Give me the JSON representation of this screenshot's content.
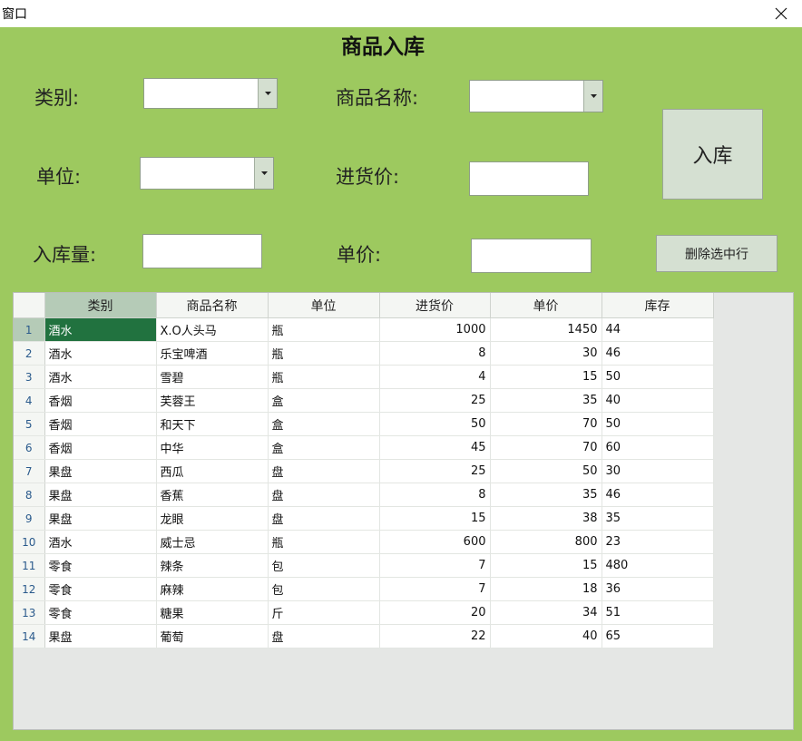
{
  "window": {
    "title": "窗口"
  },
  "form": {
    "heading": "商品入库",
    "category_label": "类别:",
    "category_value": "",
    "product_name_label": "商品名称:",
    "product_name_value": "",
    "unit_label": "单位:",
    "unit_value": "",
    "purchase_price_label": "进货价:",
    "purchase_price_value": "",
    "quantity_label": "入库量:",
    "quantity_value": "",
    "unit_price_label": "单价:",
    "unit_price_value": "",
    "stock_in_button": "入库",
    "delete_button": "删除选中行"
  },
  "grid": {
    "columns": [
      "类别",
      "商品名称",
      "单位",
      "进货价",
      "单价",
      "库存"
    ],
    "rows": [
      [
        "1",
        "酒水",
        "X.O人头马",
        "瓶",
        "1000",
        "1450",
        "44"
      ],
      [
        "2",
        "酒水",
        "乐宝啤酒",
        "瓶",
        "8",
        "30",
        "46"
      ],
      [
        "3",
        "酒水",
        "雪碧",
        "瓶",
        "4",
        "15",
        "50"
      ],
      [
        "4",
        "香烟",
        "芙蓉王",
        "盒",
        "25",
        "35",
        "40"
      ],
      [
        "5",
        "香烟",
        "和天下",
        "盒",
        "50",
        "70",
        "50"
      ],
      [
        "6",
        "香烟",
        "中华",
        "盒",
        "45",
        "70",
        "60"
      ],
      [
        "7",
        "果盘",
        "西瓜",
        "盘",
        "25",
        "50",
        "30"
      ],
      [
        "8",
        "果盘",
        "香蕉",
        "盘",
        "8",
        "35",
        "46"
      ],
      [
        "9",
        "果盘",
        "龙眼",
        "盘",
        "15",
        "38",
        "35"
      ],
      [
        "10",
        "酒水",
        "威士忌",
        "瓶",
        "600",
        "800",
        "23"
      ],
      [
        "11",
        "零食",
        "辣条",
        "包",
        "7",
        "15",
        "480"
      ],
      [
        "12",
        "零食",
        "麻辣",
        "包",
        "7",
        "18",
        "36"
      ],
      [
        "13",
        "零食",
        "糖果",
        "斤",
        "20",
        "34",
        "51"
      ],
      [
        "14",
        "果盘",
        "葡萄",
        "盘",
        "22",
        "40",
        "65"
      ]
    ]
  },
  "colors": {
    "form_background": "#9dc95f",
    "selected_cell": "#21723f",
    "button": "#d5e0d2"
  },
  "icons": {
    "close": "close-icon",
    "dropdown": "chevron-down-icon"
  }
}
